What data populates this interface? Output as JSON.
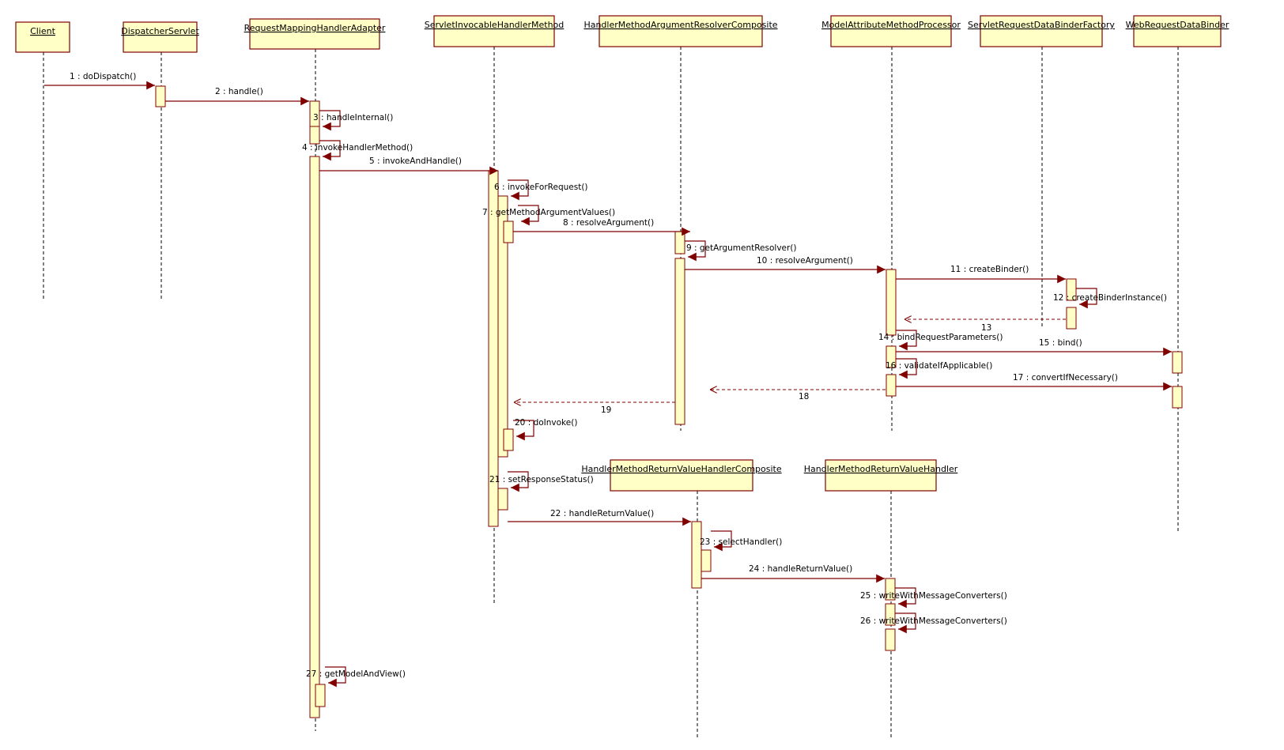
{
  "diagram": {
    "type": "uml-sequence",
    "colors": {
      "box_fill": "#ffffc6",
      "border": "#800000",
      "arrow": "#800000",
      "text": "#000000"
    },
    "lifelines": [
      {
        "id": "client",
        "name": "Client"
      },
      {
        "id": "ds",
        "name": "DispatcherServlet"
      },
      {
        "id": "rmha",
        "name": "RequestMappingHandlerAdapter"
      },
      {
        "id": "sihm",
        "name": "ServletInvocableHandlerMethod"
      },
      {
        "id": "hmarc",
        "name": "HandlerMethodArgumentResolverComposite"
      },
      {
        "id": "mamp",
        "name": "ModelAttributeMethodProcessor"
      },
      {
        "id": "srdbf",
        "name": "ServletRequestDataBinderFactory"
      },
      {
        "id": "wrdb",
        "name": "WebRequestDataBinder"
      },
      {
        "id": "hmrvhc",
        "name": "HandlerMethodReturnValueHandlerComposite"
      },
      {
        "id": "hmrvh",
        "name": "HandlerMethodReturnValueHandler"
      }
    ],
    "messages": [
      {
        "n": 1,
        "label": "1 : doDispatch()",
        "from": "client",
        "to": "ds",
        "kind": "call"
      },
      {
        "n": 2,
        "label": "2 : handle()",
        "from": "ds",
        "to": "rmha",
        "kind": "call"
      },
      {
        "n": 3,
        "label": "3 : handleInternal()",
        "from": "rmha",
        "to": "rmha",
        "kind": "self"
      },
      {
        "n": 4,
        "label": "4 : invokeHandlerMethod()",
        "from": "rmha",
        "to": "rmha",
        "kind": "self"
      },
      {
        "n": 5,
        "label": "5 : invokeAndHandle()",
        "from": "rmha",
        "to": "sihm",
        "kind": "call"
      },
      {
        "n": 6,
        "label": "6 : invokeForRequest()",
        "from": "sihm",
        "to": "sihm",
        "kind": "self"
      },
      {
        "n": 7,
        "label": "7 : getMethodArgumentValues()",
        "from": "sihm",
        "to": "sihm",
        "kind": "self"
      },
      {
        "n": 8,
        "label": "8 : resolveArgument()",
        "from": "sihm",
        "to": "hmarc",
        "kind": "call"
      },
      {
        "n": 9,
        "label": "9 : getArgumentResolver()",
        "from": "hmarc",
        "to": "hmarc",
        "kind": "self"
      },
      {
        "n": 10,
        "label": "10 : resolveArgument()",
        "from": "hmarc",
        "to": "mamp",
        "kind": "call"
      },
      {
        "n": 11,
        "label": "11 : createBinder()",
        "from": "mamp",
        "to": "srdbf",
        "kind": "call"
      },
      {
        "n": 12,
        "label": "12 : createBinderInstance()",
        "from": "srdbf",
        "to": "srdbf",
        "kind": "self"
      },
      {
        "n": 13,
        "label": "13",
        "from": "srdbf",
        "to": "mamp",
        "kind": "return"
      },
      {
        "n": 14,
        "label": "14 : bindRequestParameters()",
        "from": "mamp",
        "to": "mamp",
        "kind": "self"
      },
      {
        "n": 15,
        "label": "15 : bind()",
        "from": "mamp",
        "to": "wrdb",
        "kind": "call"
      },
      {
        "n": 16,
        "label": "16 : validateIfApplicable()",
        "from": "mamp",
        "to": "mamp",
        "kind": "self"
      },
      {
        "n": 17,
        "label": "17 : convertIfNecessary()",
        "from": "mamp",
        "to": "wrdb",
        "kind": "call"
      },
      {
        "n": 18,
        "label": "18",
        "from": "mamp",
        "to": "hmarc",
        "kind": "return"
      },
      {
        "n": 19,
        "label": "19",
        "from": "hmarc",
        "to": "sihm",
        "kind": "return"
      },
      {
        "n": 20,
        "label": "20 : doInvoke()",
        "from": "sihm",
        "to": "sihm",
        "kind": "self"
      },
      {
        "n": 21,
        "label": "21 : setResponseStatus()",
        "from": "sihm",
        "to": "sihm",
        "kind": "self"
      },
      {
        "n": 22,
        "label": "22 : handleReturnValue()",
        "from": "sihm",
        "to": "hmrvhc",
        "kind": "call"
      },
      {
        "n": 23,
        "label": "23 : selectHandler()",
        "from": "hmrvhc",
        "to": "hmrvhc",
        "kind": "self"
      },
      {
        "n": 24,
        "label": "24 : handleReturnValue()",
        "from": "hmrvhc",
        "to": "hmrvh",
        "kind": "call"
      },
      {
        "n": 25,
        "label": "25 : writeWithMessageConverters()",
        "from": "hmrvh",
        "to": "hmrvh",
        "kind": "self"
      },
      {
        "n": 26,
        "label": "26 : writeWithMessageConverters()",
        "from": "hmrvh",
        "to": "hmrvh",
        "kind": "self"
      },
      {
        "n": 27,
        "label": "27 : getModelAndView()",
        "from": "rmha",
        "to": "rmha",
        "kind": "self"
      }
    ]
  }
}
